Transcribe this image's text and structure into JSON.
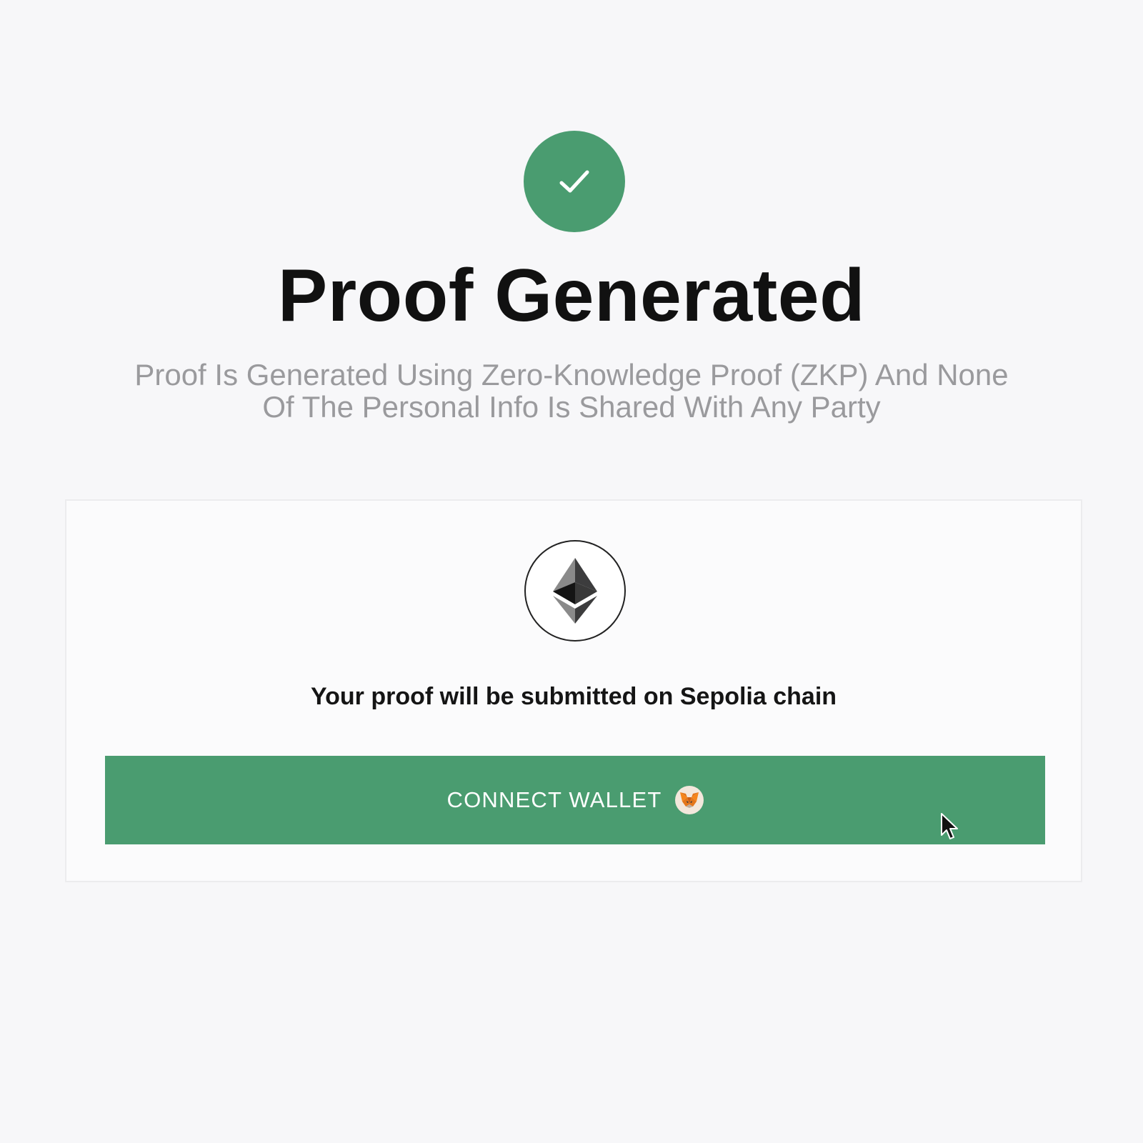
{
  "header": {
    "title": "Proof Generated",
    "subtitle_line1": "Proof Is Generated Using Zero-Knowledge Proof (ZKP) And None",
    "subtitle_line2": "Of The Personal Info Is Shared With Any Party"
  },
  "card": {
    "chain_icon": "ethereum-icon",
    "message": "Your proof will be submitted on Sepolia chain",
    "connect_button": {
      "label": "CONNECT WALLET",
      "icon": "metamask-fox-icon"
    }
  },
  "colors": {
    "accent": "#4a9c70",
    "background": "#f7f7f9",
    "subtitle": "#9a9a9d",
    "title": "#111111"
  },
  "icons": {
    "success": "checkmark-icon",
    "cursor": "mouse-pointer-icon"
  }
}
